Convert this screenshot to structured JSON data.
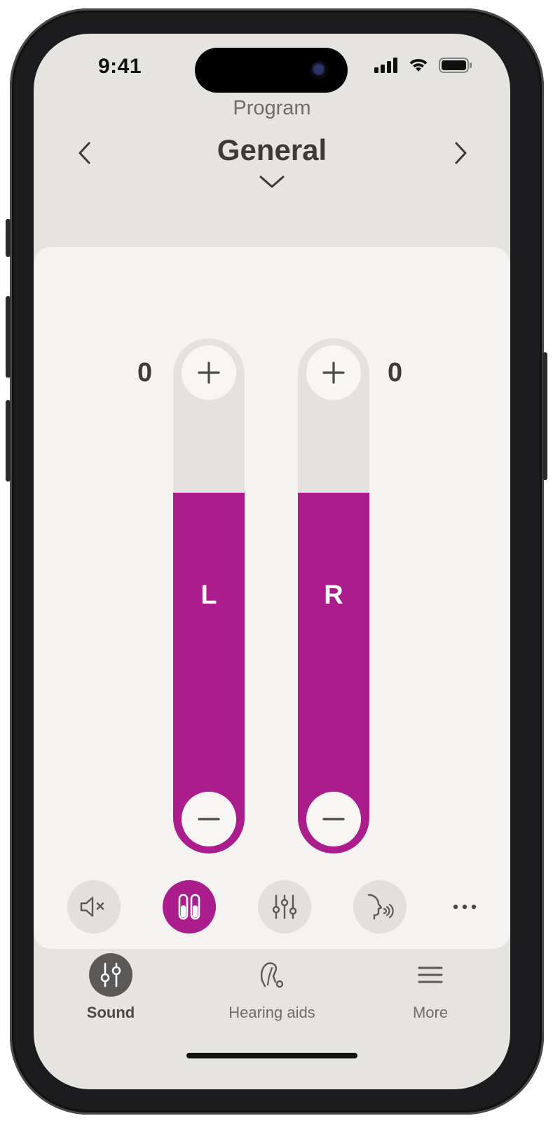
{
  "status_bar": {
    "time": "9:41",
    "icons": [
      "cellular-signal-icon",
      "wifi-icon",
      "battery-icon"
    ]
  },
  "header": {
    "program_label": "Program",
    "program_name": "General",
    "prev_icon": "chevron-left-icon",
    "next_icon": "chevron-right-icon",
    "dropdown_icon": "chevron-down-icon"
  },
  "volume": {
    "left": {
      "value": "0",
      "label": "L",
      "fill_fraction": 0.7
    },
    "right": {
      "value": "0",
      "label": "R",
      "fill_fraction": 0.7
    }
  },
  "quick_actions": [
    {
      "icon": "mute-icon",
      "active": false
    },
    {
      "icon": "linked-sides-icon",
      "active": true
    },
    {
      "icon": "equalizer-icon",
      "active": false
    },
    {
      "icon": "speech-focus-icon",
      "active": false
    },
    {
      "icon": "more-icon",
      "active": false
    }
  ],
  "tabs": [
    {
      "label": "Sound",
      "icon": "sound-sliders-icon",
      "active": true
    },
    {
      "label": "Hearing aids",
      "icon": "hearing-aid-icon",
      "active": false
    },
    {
      "label": "More",
      "icon": "menu-icon",
      "active": false
    }
  ],
  "colors": {
    "accent": "#ab1c8c",
    "background": "#e6e4e1",
    "panel": "#f4f3f1",
    "text_dark": "#3d3b39",
    "text_muted": "#6f6d6a"
  }
}
